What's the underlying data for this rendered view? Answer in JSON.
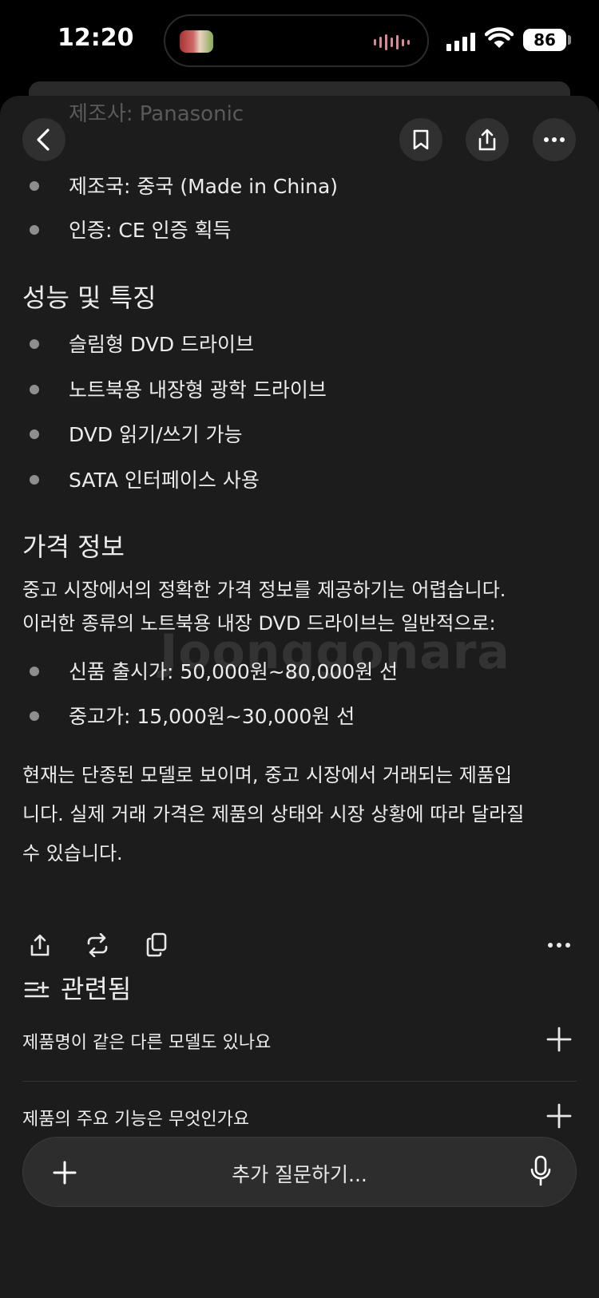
{
  "status_bar": {
    "time": "12:20",
    "battery": "86"
  },
  "header": {
    "faded_text": "제조사: Panasonic",
    "back_icon": "chevron-left-icon",
    "bookmark_icon": "bookmark-icon",
    "share_icon": "share-icon",
    "more_icon": "ellipsis-icon"
  },
  "spec_items": [
    "제조국: 중국 (Made in China)",
    "인증: CE 인증 획득"
  ],
  "features": {
    "heading": "성능 및 특징",
    "items": [
      "슬림형 DVD 드라이브",
      "노트북용 내장형 광학 드라이브",
      "DVD 읽기/쓰기 가능",
      "SATA 인터페이스 사용"
    ]
  },
  "price": {
    "heading": "가격 정보",
    "intro_line1": "중고 시장에서의 정확한 가격 정보를 제공하기는 어렵습니다.",
    "intro_line2": "이러한 종류의 노트북용 내장 DVD 드라이브는 일반적으로:",
    "items": [
      "신품 출시가: 50,000원~80,000원 선",
      "중고가: 15,000원~30,000원 선"
    ],
    "summary_line1": "현재는 단종된 모델로 보이며, 중고 시장에서 거래되는 제품입",
    "summary_line2": "니다. 실제 거래 가격은 제품의 상태와 시장 상황에 따라 달라질",
    "summary_line3": "수 있습니다."
  },
  "watermark": "Joonggonara",
  "actions": [
    "share-icon",
    "rewrite-icon",
    "copy-icon",
    "more-icon"
  ],
  "related": {
    "title": "관련됨",
    "items": [
      "제품명이 같은 다른 모델도 있나요",
      "제품의 주요 기능은 무엇인가요"
    ]
  },
  "composer": {
    "placeholder": "추가 질문하기..."
  }
}
